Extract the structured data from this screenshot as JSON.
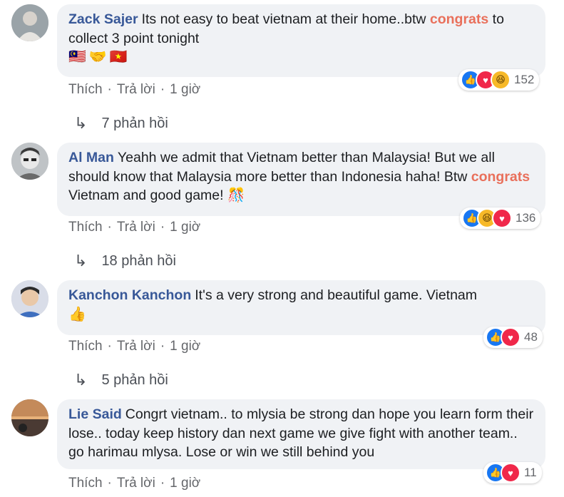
{
  "comments": [
    {
      "author": "Zack Sajer",
      "text_before": "Its not easy to beat vietnam at their home..btw ",
      "highlight": "congrats",
      "text_after": " to collect 3 point tonight",
      "emoji_line": [
        "🇲🇾",
        "🤝",
        "🇻🇳"
      ],
      "actions": {
        "like": "Thích",
        "reply": "Trả lời",
        "time": "1 giờ"
      },
      "reactions": {
        "icons": [
          "like",
          "love",
          "haha"
        ],
        "count": "152"
      },
      "replies_label": "7 phản hồi"
    },
    {
      "author": "Al Man",
      "text_before": "Yeahh we admit that Vietnam better than Malaysia! But we all should know that Malaysia more better than Indonesia haha! Btw ",
      "highlight": "congrats",
      "text_after": " Vietnam and good game! 🎊",
      "actions": {
        "like": "Thích",
        "reply": "Trả lời",
        "time": "1 giờ"
      },
      "reactions": {
        "icons": [
          "like",
          "haha",
          "love"
        ],
        "count": "136"
      },
      "replies_label": "18 phản hồi"
    },
    {
      "author": "Kanchon Kanchon",
      "text_before": "It's a very strong and beautiful game. Vietnam",
      "emoji_line": [
        "👍"
      ],
      "actions": {
        "like": "Thích",
        "reply": "Trả lời",
        "time": "1 giờ"
      },
      "reactions": {
        "icons": [
          "like",
          "love"
        ],
        "count": "48"
      },
      "replies_label": "5 phản hồi"
    },
    {
      "author": "Lie Said",
      "text_before": "Congrt vietnam.. to mlysia be strong dan hope you learn form their lose.. today keep history dan next game we give fight with another team.. go harimau mlysa. Lose or win we still behind you",
      "actions": {
        "like": "Thích",
        "reply": "Trả lời",
        "time": "1 giờ"
      },
      "reactions": {
        "icons": [
          "like",
          "love"
        ],
        "count": "11"
      }
    }
  ],
  "colors": {
    "author": "#385898",
    "highlight": "#e9705b",
    "bubble": "#f0f2f5",
    "meta": "#65676b"
  }
}
